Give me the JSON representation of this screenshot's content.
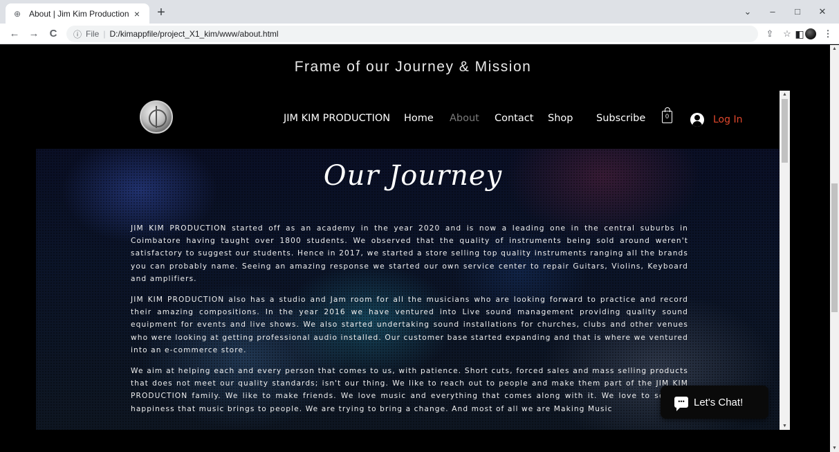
{
  "browser": {
    "tab_title": "About | Jim Kim Production",
    "tab_close": "×",
    "new_tab": "+",
    "url_info_icon": "ⓘ",
    "url_scheme": "File",
    "url_path": "D:/kimappfile/project_X1_kim/www/about.html",
    "controls": {
      "tab_search": "⌄",
      "minimize": "–",
      "maximize": "□",
      "close": "✕"
    },
    "nav": {
      "back": "←",
      "forward": "→",
      "reload": "C"
    }
  },
  "page": {
    "tagline": "Frame of our Journey & Mission",
    "nav": {
      "brand": "JIM KIM PRODUCTION",
      "home": "Home",
      "about": "About",
      "contact": "Contact",
      "shop": "Shop",
      "subscribe": "Subscribe",
      "cart_count": "0",
      "login": "Log In"
    },
    "heading": "Our Journey",
    "paragraphs": [
      "JIM KIM PRODUCTION started off as an academy in the year 2020 and is now a leading one in the central suburbs in Coimbatore having taught over 1800 students. We observed that the quality of instruments being sold around weren't satisfactory to suggest our students. Hence in 2017, we started a store selling top quality instruments ranging all the brands you can probably name. Seeing an amazing response we started our own service center to repair Guitars, Violins, Keyboard and amplifiers.",
      "JIM KIM PRODUCTION also has a studio and Jam room for all the musicians who are looking forward to practice and record their amazing compositions. In the year 2016 we have ventured into Live sound management providing quality sound equipment for events and live shows. We also started undertaking  sound installations for churches, clubs and other venues who were looking at getting professional audio installed. Our customer base started expanding and that is where we ventured into an e-commerce store.",
      "We aim at helping each and every person that comes to us, with patience. Short cuts, forced sales and mass selling products that does not meet our quality standards; isn't our thing.  We like to reach out to people and make them part of the JIM KIM PRODUCTION family. We like to make friends. We love music and everything that comes along with it. We love to see the happiness that music brings to people. We are trying to bring a change. And most of all we are Making Music"
    ],
    "chat_label": "Let's Chat!"
  },
  "colors": {
    "login": "#e0472c",
    "nav_active": "#7b7b7b",
    "background": "#000000"
  }
}
